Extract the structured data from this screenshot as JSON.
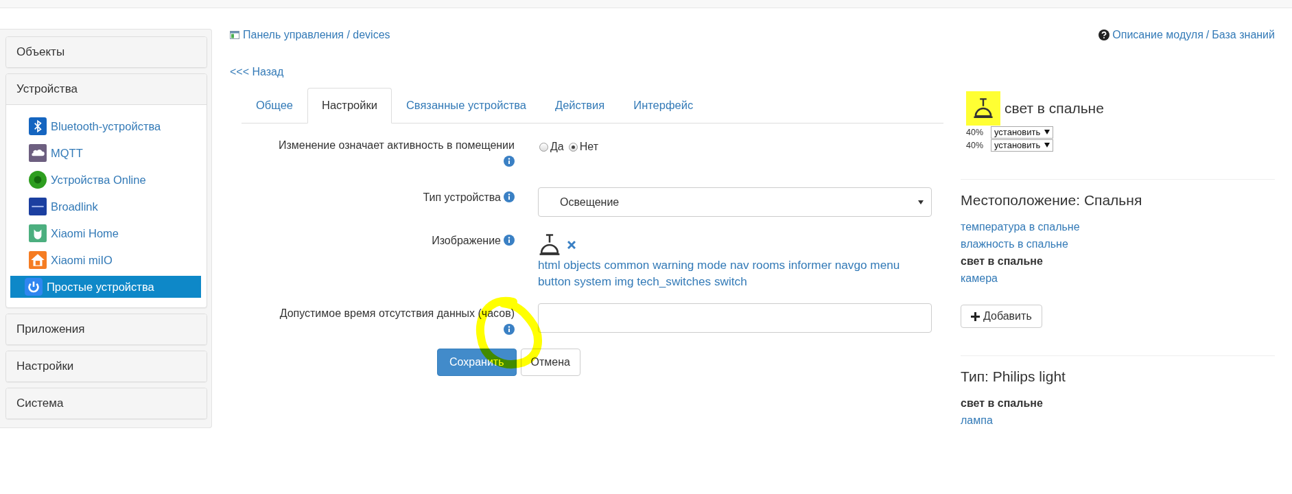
{
  "sidebar": {
    "sections": [
      {
        "title": "Объекты",
        "expanded": false
      },
      {
        "title": "Устройства",
        "expanded": true,
        "items": [
          {
            "label": "Bluetooth-устройства",
            "selected": false
          },
          {
            "label": "MQTT",
            "selected": false
          },
          {
            "label": "Устройства Online",
            "selected": false
          },
          {
            "label": "Broadlink",
            "selected": false
          },
          {
            "label": "Xiaomi Home",
            "selected": false
          },
          {
            "label": "Xiaomi miIO",
            "selected": false
          },
          {
            "label": "Простые устройства",
            "selected": true
          }
        ]
      },
      {
        "title": "Приложения",
        "expanded": false
      },
      {
        "title": "Настройки",
        "expanded": false
      },
      {
        "title": "Система",
        "expanded": false
      }
    ]
  },
  "breadcrumb": "Панель управления / devices",
  "help": {
    "links": [
      "Описание модуля",
      "База знаний"
    ],
    "separator": "/"
  },
  "back_link": "<<< Назад",
  "tabs": [
    {
      "label": "Общее",
      "selected": false
    },
    {
      "label": "Настройки",
      "selected": true
    },
    {
      "label": "Связанные устройства",
      "selected": false
    },
    {
      "label": "Действия",
      "selected": false
    },
    {
      "label": "Интерфейс",
      "selected": false
    }
  ],
  "form": {
    "fields": [
      {
        "kind": "radio",
        "label": "Изменение означает активность в помещении",
        "options": [
          {
            "label": "Да",
            "selected": false
          },
          {
            "label": "Нет",
            "selected": true
          }
        ]
      },
      {
        "kind": "select",
        "label": "Тип устройства",
        "value": "Освещение"
      },
      {
        "kind": "image",
        "label": "Изображение",
        "tags": "html objects common warning mode nav rooms informer navgo menu button system img tech_switches switch"
      },
      {
        "kind": "text",
        "label": "Допустимое время отсутствия данных (часов)"
      }
    ],
    "buttons": [
      {
        "label": "Сохранить",
        "kind": "primary"
      },
      {
        "label": "Отмена",
        "kind": "default"
      }
    ]
  },
  "device_card": {
    "title": "свет в спальне",
    "controls": [
      {
        "reading": "40%",
        "action": "установить"
      },
      {
        "reading": "40%",
        "action": "установить"
      }
    ]
  },
  "location": {
    "title": "Местоположение: Спальня",
    "devices": [
      {
        "label": "температура в спальне",
        "current": false
      },
      {
        "label": "влажность в спальне",
        "current": false
      },
      {
        "label": "свет в спальне",
        "current": true
      },
      {
        "label": "камера",
        "current": false
      }
    ],
    "add_button": "Добавить"
  },
  "device_type": {
    "title": "Тип: Philips light",
    "items": [
      {
        "label": "свет в спальне",
        "current": true
      },
      {
        "label": "лампа",
        "current": false
      }
    ]
  }
}
